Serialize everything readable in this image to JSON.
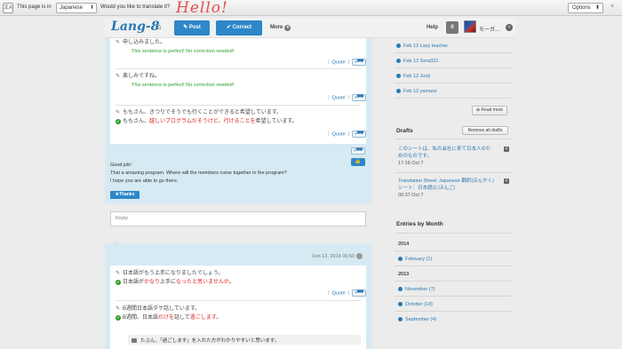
{
  "translate_bar": {
    "icon_text": "文A",
    "label": "This page is in",
    "language": "Japanese",
    "question": "Would you like to translate it?",
    "handwritten": "Hello!",
    "options_label": "Options",
    "close": "×"
  },
  "header": {
    "logo": "Lang-8",
    "post_label": "✎ Post",
    "correct_label": "✔ Correct",
    "more_label": "More",
    "help_label": "Help",
    "notification_count": "0",
    "username": "モーガ...",
    "user_close": "×"
  },
  "entry1": {
    "lines": [
      {
        "text": "申し込みました。",
        "perfect": "This sentence is perfect! No correction needed!"
      },
      {
        "text": "楽しみですね。",
        "perfect": "This sentence is perfect! No correction needed!"
      }
    ],
    "sentence3_original": "ももさん、きつりでそうでも行くことができると希望しています。",
    "sentence3_corrected_prefix": "ももさん、",
    "sentence3_corrected_red1": "越しいプログラムだそうけど",
    "sentence3_corrected_mid": "、",
    "sentence3_corrected_red2": "行けることを",
    "sentence3_corrected_suffix": "希望しています。",
    "quote_label": "Quote",
    "plus_label": "+▀▀",
    "good_lines": [
      "Good job!",
      "That a amazing program. Where will the members come together in the program?",
      "I hope you are able to go there."
    ],
    "thanks_label": "★Thanks",
    "like_label": "👍"
  },
  "reply_placeholder": "Reply",
  "entry2": {
    "date": "Feb 12, 2014 06:50",
    "s1_original": "日本語がもう上手になりましたでしょう。",
    "s1_prefix": "日本語が",
    "s1_red1": "かなり",
    "s1_mid": "上手に",
    "s1_red2": "なったと思いませんか",
    "s1_suffix": "。",
    "s2_original": "B週間日本語ダケ話しています。",
    "s2_prefix": "B週間、日本語",
    "s2_red1": "だけを",
    "s2_mid": "話して",
    "s2_red2": "過ごします",
    "s2_suffix": "。",
    "comment": "たぶん、「過ごします」を入れた方がわかりやすいと思います。",
    "quote_label": "Quote",
    "plus_label": "+▀▀"
  },
  "sidebar": {
    "recent": [
      "Feb 12 Lazy teacher",
      "Feb 12 Sora321",
      "Feb 12 Junji",
      "Feb 12 yamasx"
    ],
    "read_more": "⊕ Read more",
    "drafts_heading": "Drafts",
    "remove_all": "Remove all drafts",
    "drafts": [
      {
        "title": "このシートは、私の会社に来て日本人のためのものです。",
        "time": "17:16 Oct 7"
      },
      {
        "title": "Translation Sheet: Japanese 翻訳(ほんやく)シート：日本語(にほんご)",
        "time": "00:37 Oct 7"
      }
    ],
    "entries_heading": "Entries by Month",
    "years": [
      {
        "year": "2014",
        "months": [
          "February (1)"
        ]
      },
      {
        "year": "2013",
        "months": [
          "November (7)",
          "October (14)",
          "September (4)"
        ]
      }
    ]
  }
}
